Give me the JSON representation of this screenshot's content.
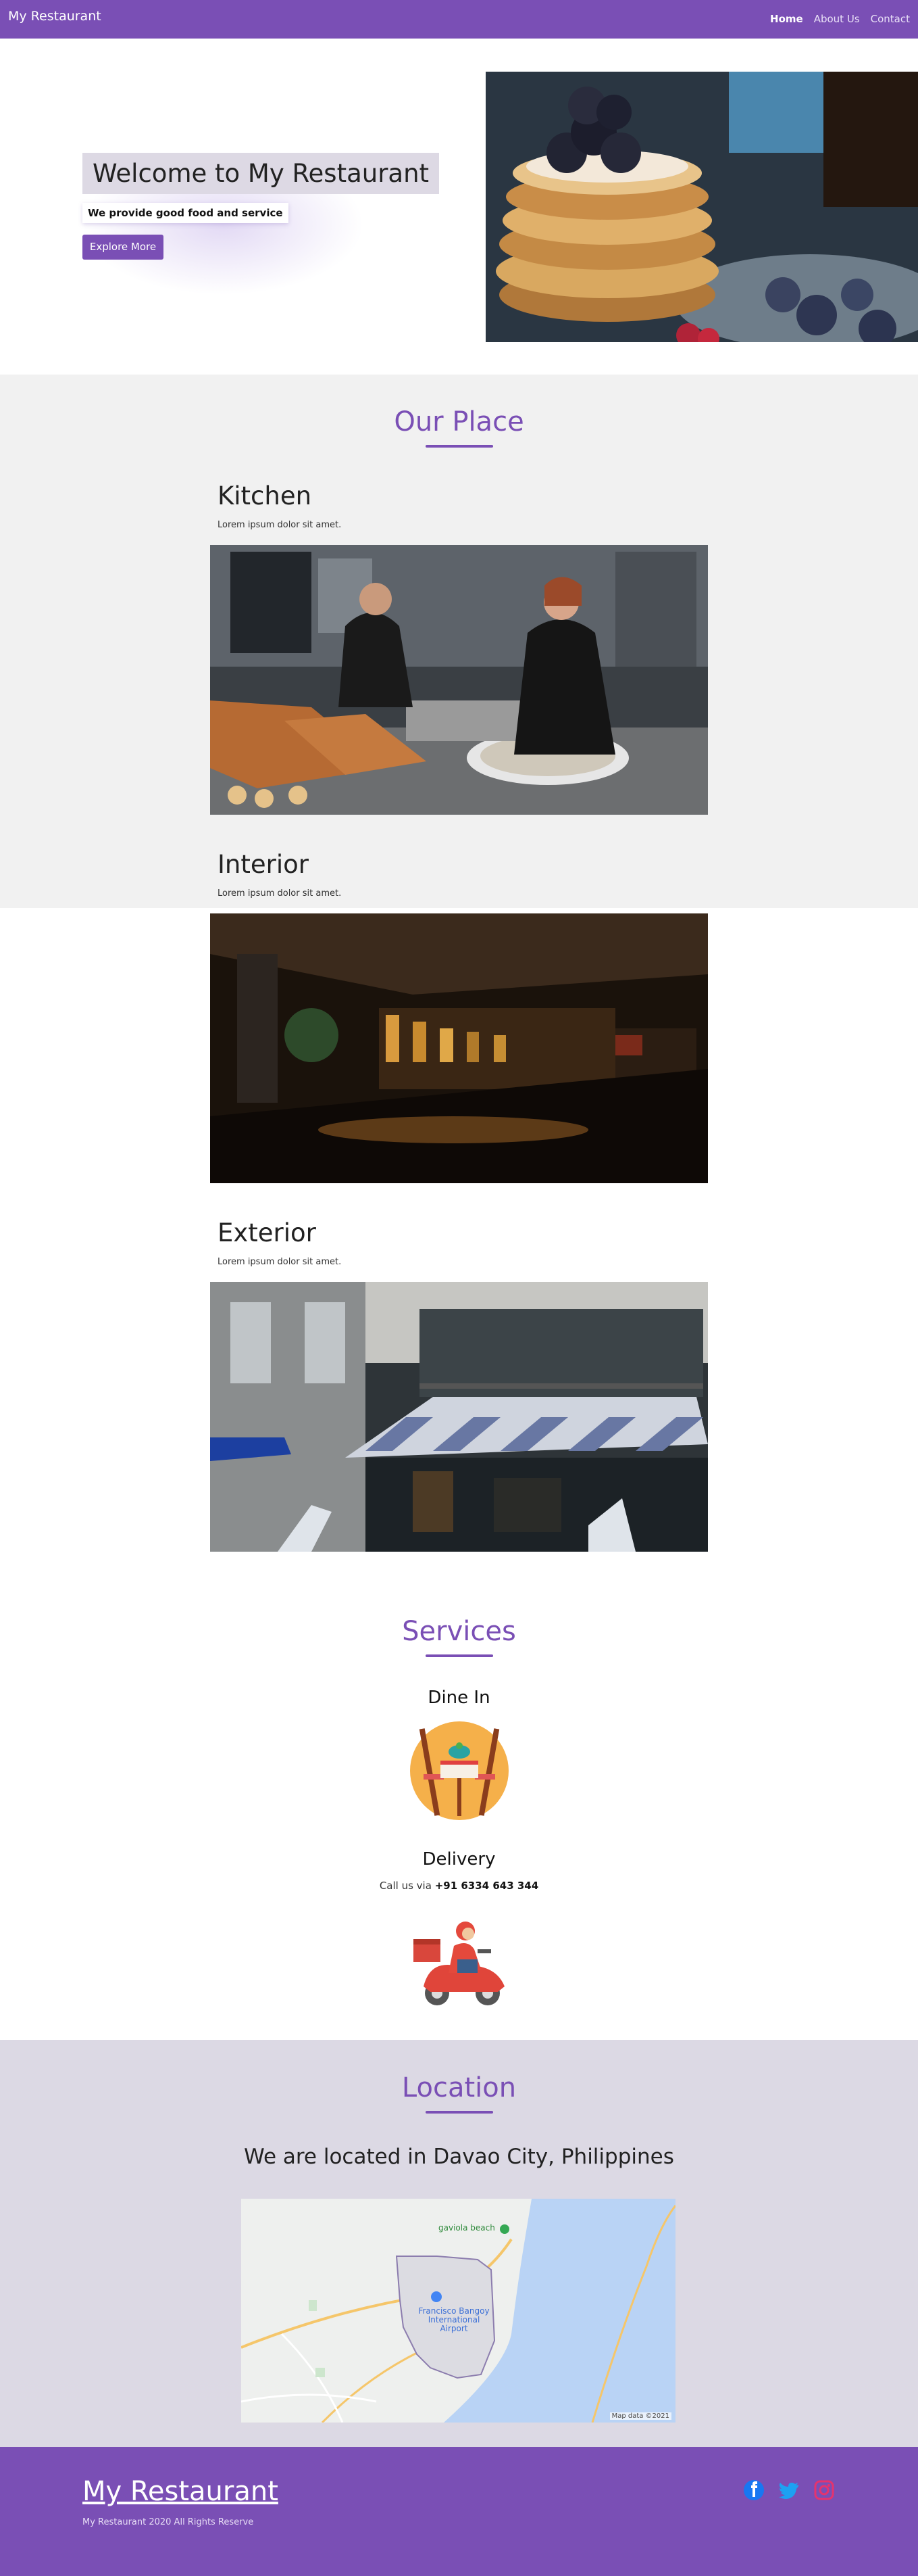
{
  "nav": {
    "brand": "My Restaurant",
    "links": [
      "Home",
      "About Us",
      "Contact"
    ]
  },
  "hero": {
    "title": "Welcome to My Restaurant",
    "subtitle": "We provide good food and service",
    "button": "Explore More"
  },
  "place": {
    "title": "Our Place",
    "cards": [
      {
        "title": "Kitchen",
        "text": "Lorem ipsum dolor sit amet."
      },
      {
        "title": "Interior",
        "text": "Lorem ipsum dolor sit amet."
      },
      {
        "title": "Exterior",
        "text": "Lorem ipsum dolor sit amet."
      }
    ]
  },
  "services": {
    "title": "Services",
    "dine_in": {
      "title": "Dine In"
    },
    "delivery": {
      "title": "Delivery",
      "call_prefix": "Call us via",
      "phone": "+91 6334 643 344"
    }
  },
  "location": {
    "title": "Location",
    "subtitle": "We are located in Davao City, Philippines",
    "map": {
      "labels": [
        "gaviola beach",
        "Francisco Bangoy International Airport"
      ],
      "attribution": "Map data ©2021"
    }
  },
  "footer": {
    "brand": "My Restaurant",
    "copyright": "My Restaurant 2020 All Rights Reserve",
    "social": [
      "facebook-icon",
      "twitter-icon",
      "instagram-icon"
    ]
  },
  "colors": {
    "primary": "#7a4fb5",
    "light_gray": "#f1f1f1",
    "location_bg": "#dcd9e4"
  }
}
